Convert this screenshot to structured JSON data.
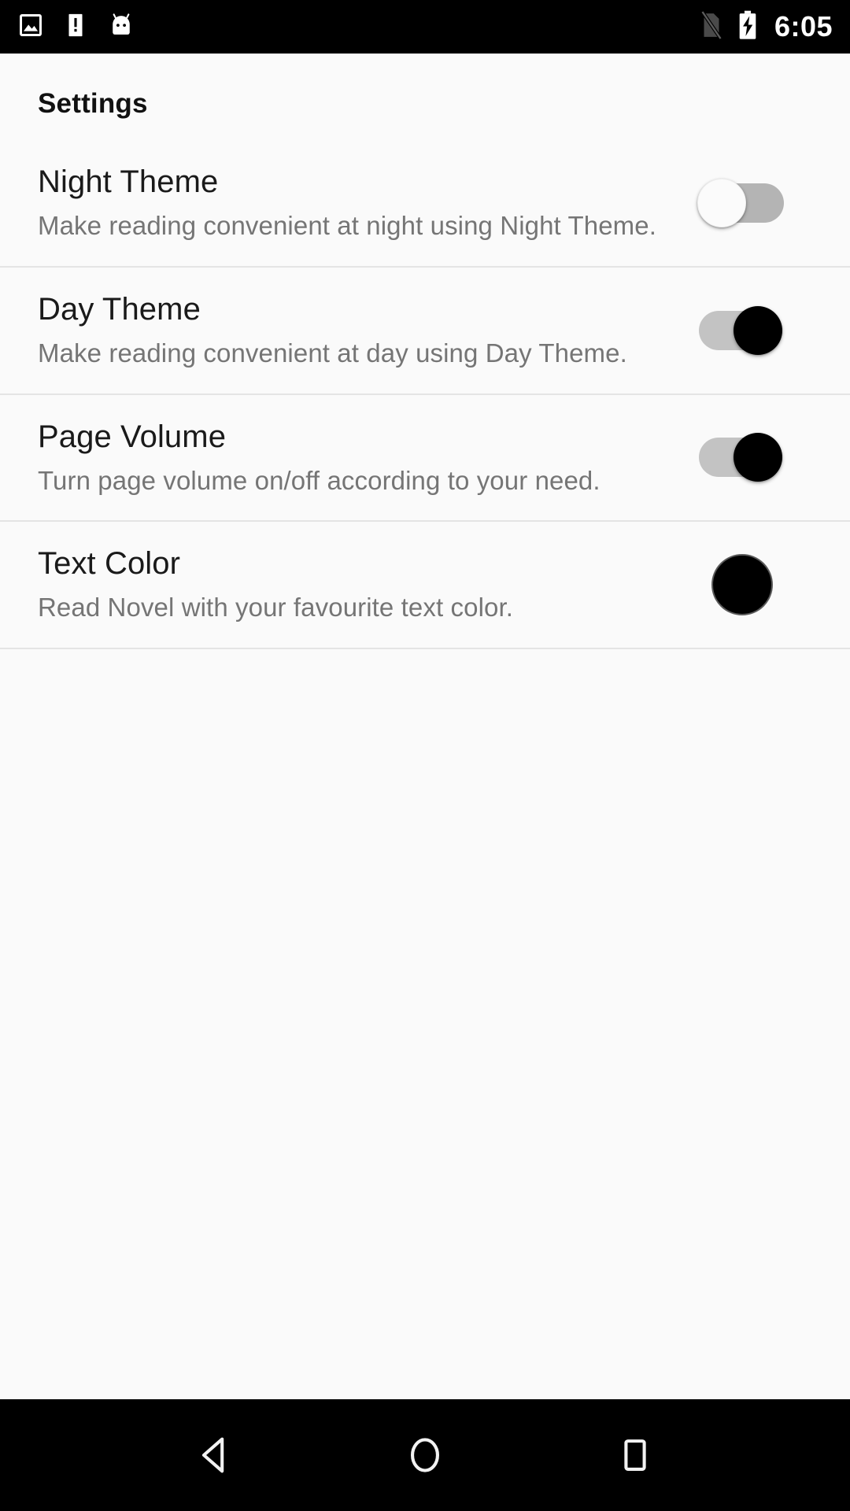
{
  "status_bar": {
    "left_icons": [
      "photo-icon",
      "alert-icon",
      "android-head-icon"
    ],
    "right_icons": [
      "no-sim-icon",
      "battery-charging-icon"
    ],
    "clock": "6:05"
  },
  "header": {
    "title": "Settings"
  },
  "settings": {
    "rows": [
      {
        "title": "Night Theme",
        "description": "Make reading convenient at night using Night Theme.",
        "control": "switch",
        "state": "off"
      },
      {
        "title": "Day Theme",
        "description": "Make reading convenient at day using Day Theme.",
        "control": "switch",
        "state": "on"
      },
      {
        "title": "Page Volume",
        "description": "Turn page volume on/off according to your need.",
        "control": "switch",
        "state": "on"
      },
      {
        "title": "Text Color",
        "description": "Read Novel with your favourite text color.",
        "control": "color-swatch",
        "color": "#000000"
      }
    ]
  },
  "nav_bar": {
    "buttons": [
      "back-icon",
      "home-icon",
      "recents-icon"
    ]
  },
  "colors": {
    "background": "#fafafa",
    "status_bar": "#000000",
    "divider": "#e4e4e4",
    "title_text": "#111111",
    "row_title_text": "#1a1a1a",
    "row_desc_text": "#757575",
    "switch_on_thumb": "#000000",
    "switch_off_thumb": "#fbfbfb"
  }
}
